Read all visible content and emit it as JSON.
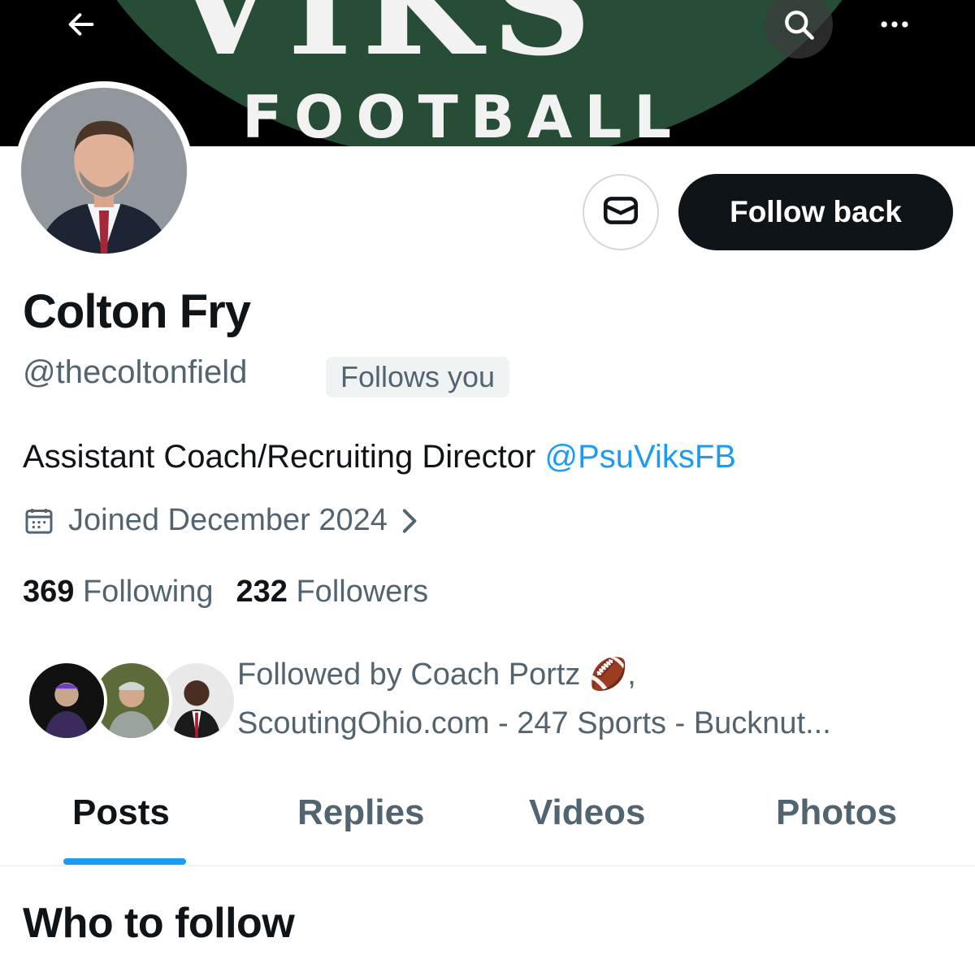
{
  "header": {
    "banner_text_top": "VIKS",
    "banner_text": "FOOTBALL",
    "icons": {
      "back": "back-arrow-icon",
      "search": "search-icon",
      "more": "more-icon"
    }
  },
  "profile": {
    "name": "Colton Fry",
    "handle": "@thecoltonfield",
    "follows_you": "Follows you",
    "bio_text": "Assistant Coach/Recruiting Director ",
    "bio_link": "@PsuViksFB",
    "joined": "Joined December 2024",
    "following_count": "369",
    "following_label": "Following",
    "followers_count": "232",
    "followers_label": "Followers"
  },
  "actions": {
    "message_icon": "envelope-icon",
    "follow_back_label": "Follow back"
  },
  "followed_by": {
    "line1": "Followed by Coach Portz 🏈,",
    "line2": "ScoutingOhio.com - 247 Sports - Bucknut..."
  },
  "tabs": [
    {
      "label": "Posts",
      "active": true
    },
    {
      "label": "Replies",
      "active": false
    },
    {
      "label": "Videos",
      "active": false
    },
    {
      "label": "Photos",
      "active": false
    }
  ],
  "who_to_follow": {
    "heading": "Who to follow"
  },
  "colors": {
    "accent": "#1d9bf0",
    "text": "#0f1419",
    "muted": "#536471",
    "banner_green": "#274d37"
  }
}
